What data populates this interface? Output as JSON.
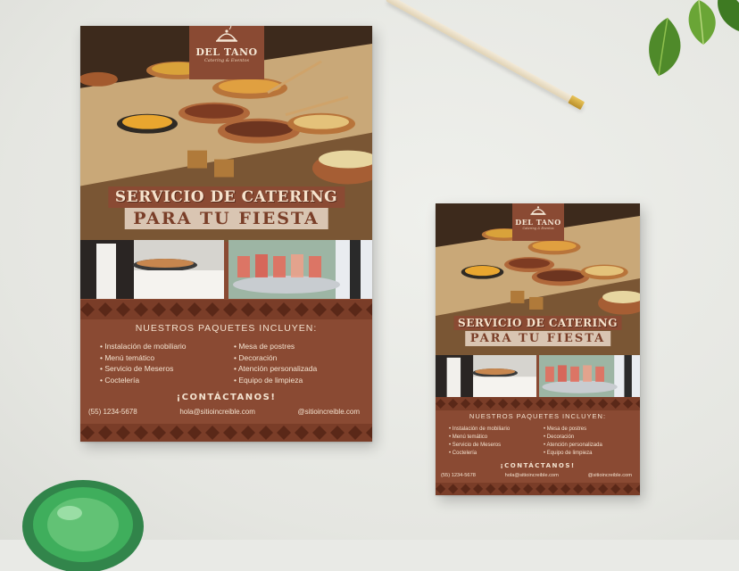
{
  "flyer": {
    "logo_name": "DEL TANO",
    "logo_sub": "Catering & Eventos",
    "title_line1": "SERVICIO DE CATERING",
    "title_line2": "PARA TU FIESTA",
    "packages_title": "NUESTROS PAQUETES INCLUYEN:",
    "packages_left": [
      "Instalación de mobiliario",
      "Menú temático",
      "Servicio de Meseros",
      "Coctelería"
    ],
    "packages_right": [
      "Mesa de postres",
      "Decoración",
      "Atención personalizada",
      "Equipo de limpieza"
    ],
    "contact_title": "¡CONTÁCTANOS!",
    "phone": "(55) 1234-5678",
    "email": "hola@sitioincreible.com",
    "social": "@sitioincreible.com"
  },
  "colors": {
    "flyer_brown": "#8a4a33",
    "cream": "#f3e2cf",
    "banner_light": "#d9c5b2",
    "background": "#e9eae6"
  }
}
